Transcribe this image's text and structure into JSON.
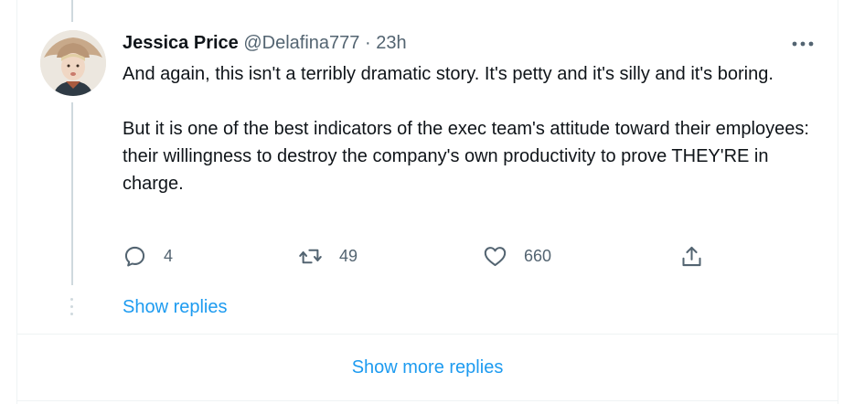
{
  "tweet": {
    "author_name": "Jessica Price",
    "handle": "@Delafina777",
    "separator": "·",
    "time": "23h",
    "paragraphs": [
      "And again, this isn't a terribly dramatic story. It's petty and it's silly and it's boring.",
      "But it is one of the best indicators of the exec team's attitude toward their employees: their willingness to destroy the company's own productivity to prove THEY'RE in charge."
    ],
    "actions": {
      "replies": "4",
      "retweets": "49",
      "likes": "660"
    }
  },
  "thread": {
    "show_replies_label": "Show replies",
    "show_more_replies_label": "Show more replies"
  },
  "icons": {
    "reply": "speech-bubble",
    "retweet": "retweet-arrows",
    "like": "heart",
    "share": "share-upload",
    "more": "ellipsis"
  },
  "colors": {
    "accent": "#1d9bf0",
    "secondary_text": "#536471",
    "primary_text": "#0f1419",
    "thread_line": "#cfd9de"
  }
}
